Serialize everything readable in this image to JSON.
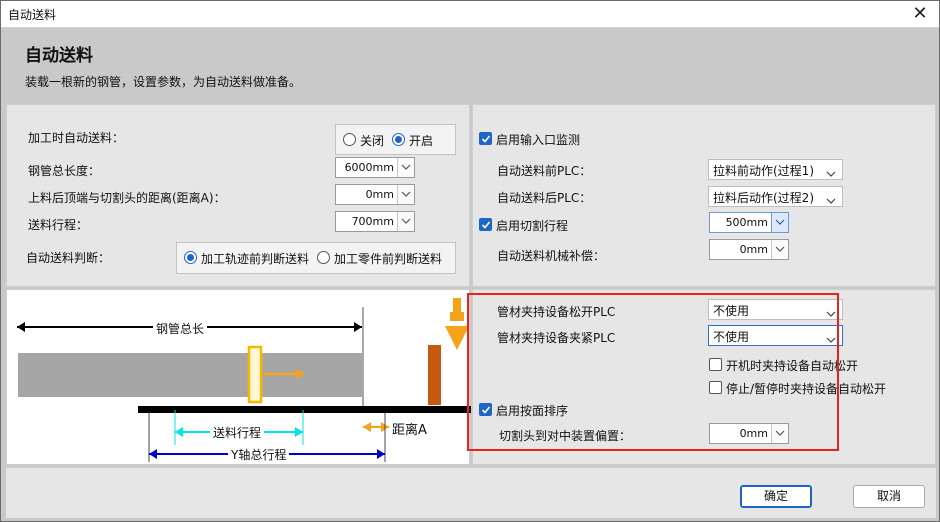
{
  "window": {
    "title": "自动送料",
    "close_glyph": "✕"
  },
  "header": {
    "title": "自动送料",
    "subtitle": "装载一根新的钢管，设置参数，为自动送料做准备。"
  },
  "left": {
    "auto_feed_label": "加工时自动送料：",
    "auto_feed_options": [
      "关闭",
      "开启"
    ],
    "auto_feed_selected": "开启",
    "pipe_length_label": "钢管总长度：",
    "pipe_length_value": "6000mm",
    "distance_label": "上料后顶端与切割头的距离(距离A)：",
    "distance_value": "0mm",
    "feed_stroke_label": "送料行程：",
    "feed_stroke_value": "700mm",
    "judge_label": "自动送料判断：",
    "judge_options": [
      "加工轨迹前判断送料",
      "加工零件前判断送料"
    ],
    "judge_selected": "加工轨迹前判断送料"
  },
  "right_top": {
    "input_monitor_label": "启用输入口监测",
    "input_monitor_checked": true,
    "pre_plc_label": "自动送料前PLC：",
    "pre_plc_value": "拉料前动作(过程1)",
    "post_plc_label": "自动送料后PLC：",
    "post_plc_value": "拉料后动作(过程2)",
    "cut_stroke_label": "启用切割行程",
    "cut_stroke_checked": true,
    "cut_stroke_value": "500mm",
    "comp_label": "自动送料机械补偿：",
    "comp_value": "0mm"
  },
  "right_bottom": {
    "release_plc_label": "管材夹持设备松开PLC",
    "release_plc_value": "不使用",
    "clamp_plc_label": "管材夹持设备夹紧PLC",
    "clamp_plc_value": "不使用",
    "auto_release_on_start_label": "开机时夹持设备自动松开",
    "auto_release_on_start_checked": false,
    "auto_release_on_stop_label": "停止/暂停时夹持设备自动松开",
    "auto_release_on_stop_checked": false,
    "face_sort_label": "启用按面排序",
    "face_sort_checked": true,
    "offset_label": "切割头到对中装置偏置：",
    "offset_value": "0mm"
  },
  "diagram": {
    "pipe_length_label": "钢管总长",
    "feed_stroke_label": "送料行程",
    "distance_label": "距离A",
    "y_stroke_label": "Y轴总行程",
    "colors": {
      "pipe": "#a6a6a6",
      "rail": "#000000",
      "head": "#c65a11",
      "arrow": "#f5a31a",
      "stroke": "#00e5e5",
      "y_axis": "#0000cc"
    }
  },
  "footer": {
    "ok_label": "确定",
    "cancel_label": "取消"
  }
}
